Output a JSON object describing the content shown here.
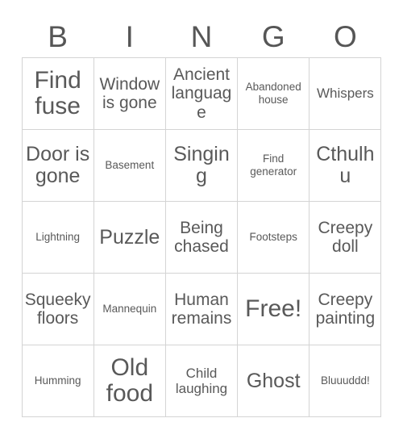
{
  "header": {
    "letters": [
      "B",
      "I",
      "N",
      "G",
      "O"
    ]
  },
  "colors": {
    "text": "#595959",
    "header_text": "#565656",
    "border": "#d4d4d4",
    "cell_background": "#ffffff",
    "page_background": "#ffffff"
  },
  "grid": {
    "rows": 5,
    "columns": 5,
    "cells": [
      [
        {
          "label": "Find fuse",
          "size": "xl"
        },
        {
          "label": "Window is gone",
          "size": "md"
        },
        {
          "label": "Ancient language",
          "size": "md"
        },
        {
          "label": "Abandoned house",
          "size": "xs"
        },
        {
          "label": "Whispers",
          "size": "sm"
        }
      ],
      [
        {
          "label": "Door is gone",
          "size": "lg"
        },
        {
          "label": "Basement",
          "size": "xs"
        },
        {
          "label": "Singing",
          "size": "lg"
        },
        {
          "label": "Find generator",
          "size": "xs"
        },
        {
          "label": "Cthulhu",
          "size": "lg"
        }
      ],
      [
        {
          "label": "Lightning",
          "size": "xs"
        },
        {
          "label": "Puzzle",
          "size": "lg"
        },
        {
          "label": "Being chased",
          "size": "md"
        },
        {
          "label": "Footsteps",
          "size": "xs"
        },
        {
          "label": "Creepy doll",
          "size": "md"
        }
      ],
      [
        {
          "label": "Squeeky floors",
          "size": "md"
        },
        {
          "label": "Mannequin",
          "size": "xs"
        },
        {
          "label": "Human remains",
          "size": "md"
        },
        {
          "label": "Free!",
          "size": "xl"
        },
        {
          "label": "Creepy painting",
          "size": "md"
        }
      ],
      [
        {
          "label": "Humming",
          "size": "xs"
        },
        {
          "label": "Old food",
          "size": "xl"
        },
        {
          "label": "Child laughing",
          "size": "sm"
        },
        {
          "label": "Ghost",
          "size": "lg"
        },
        {
          "label": "Bluuuddd!",
          "size": "xs"
        }
      ]
    ]
  }
}
